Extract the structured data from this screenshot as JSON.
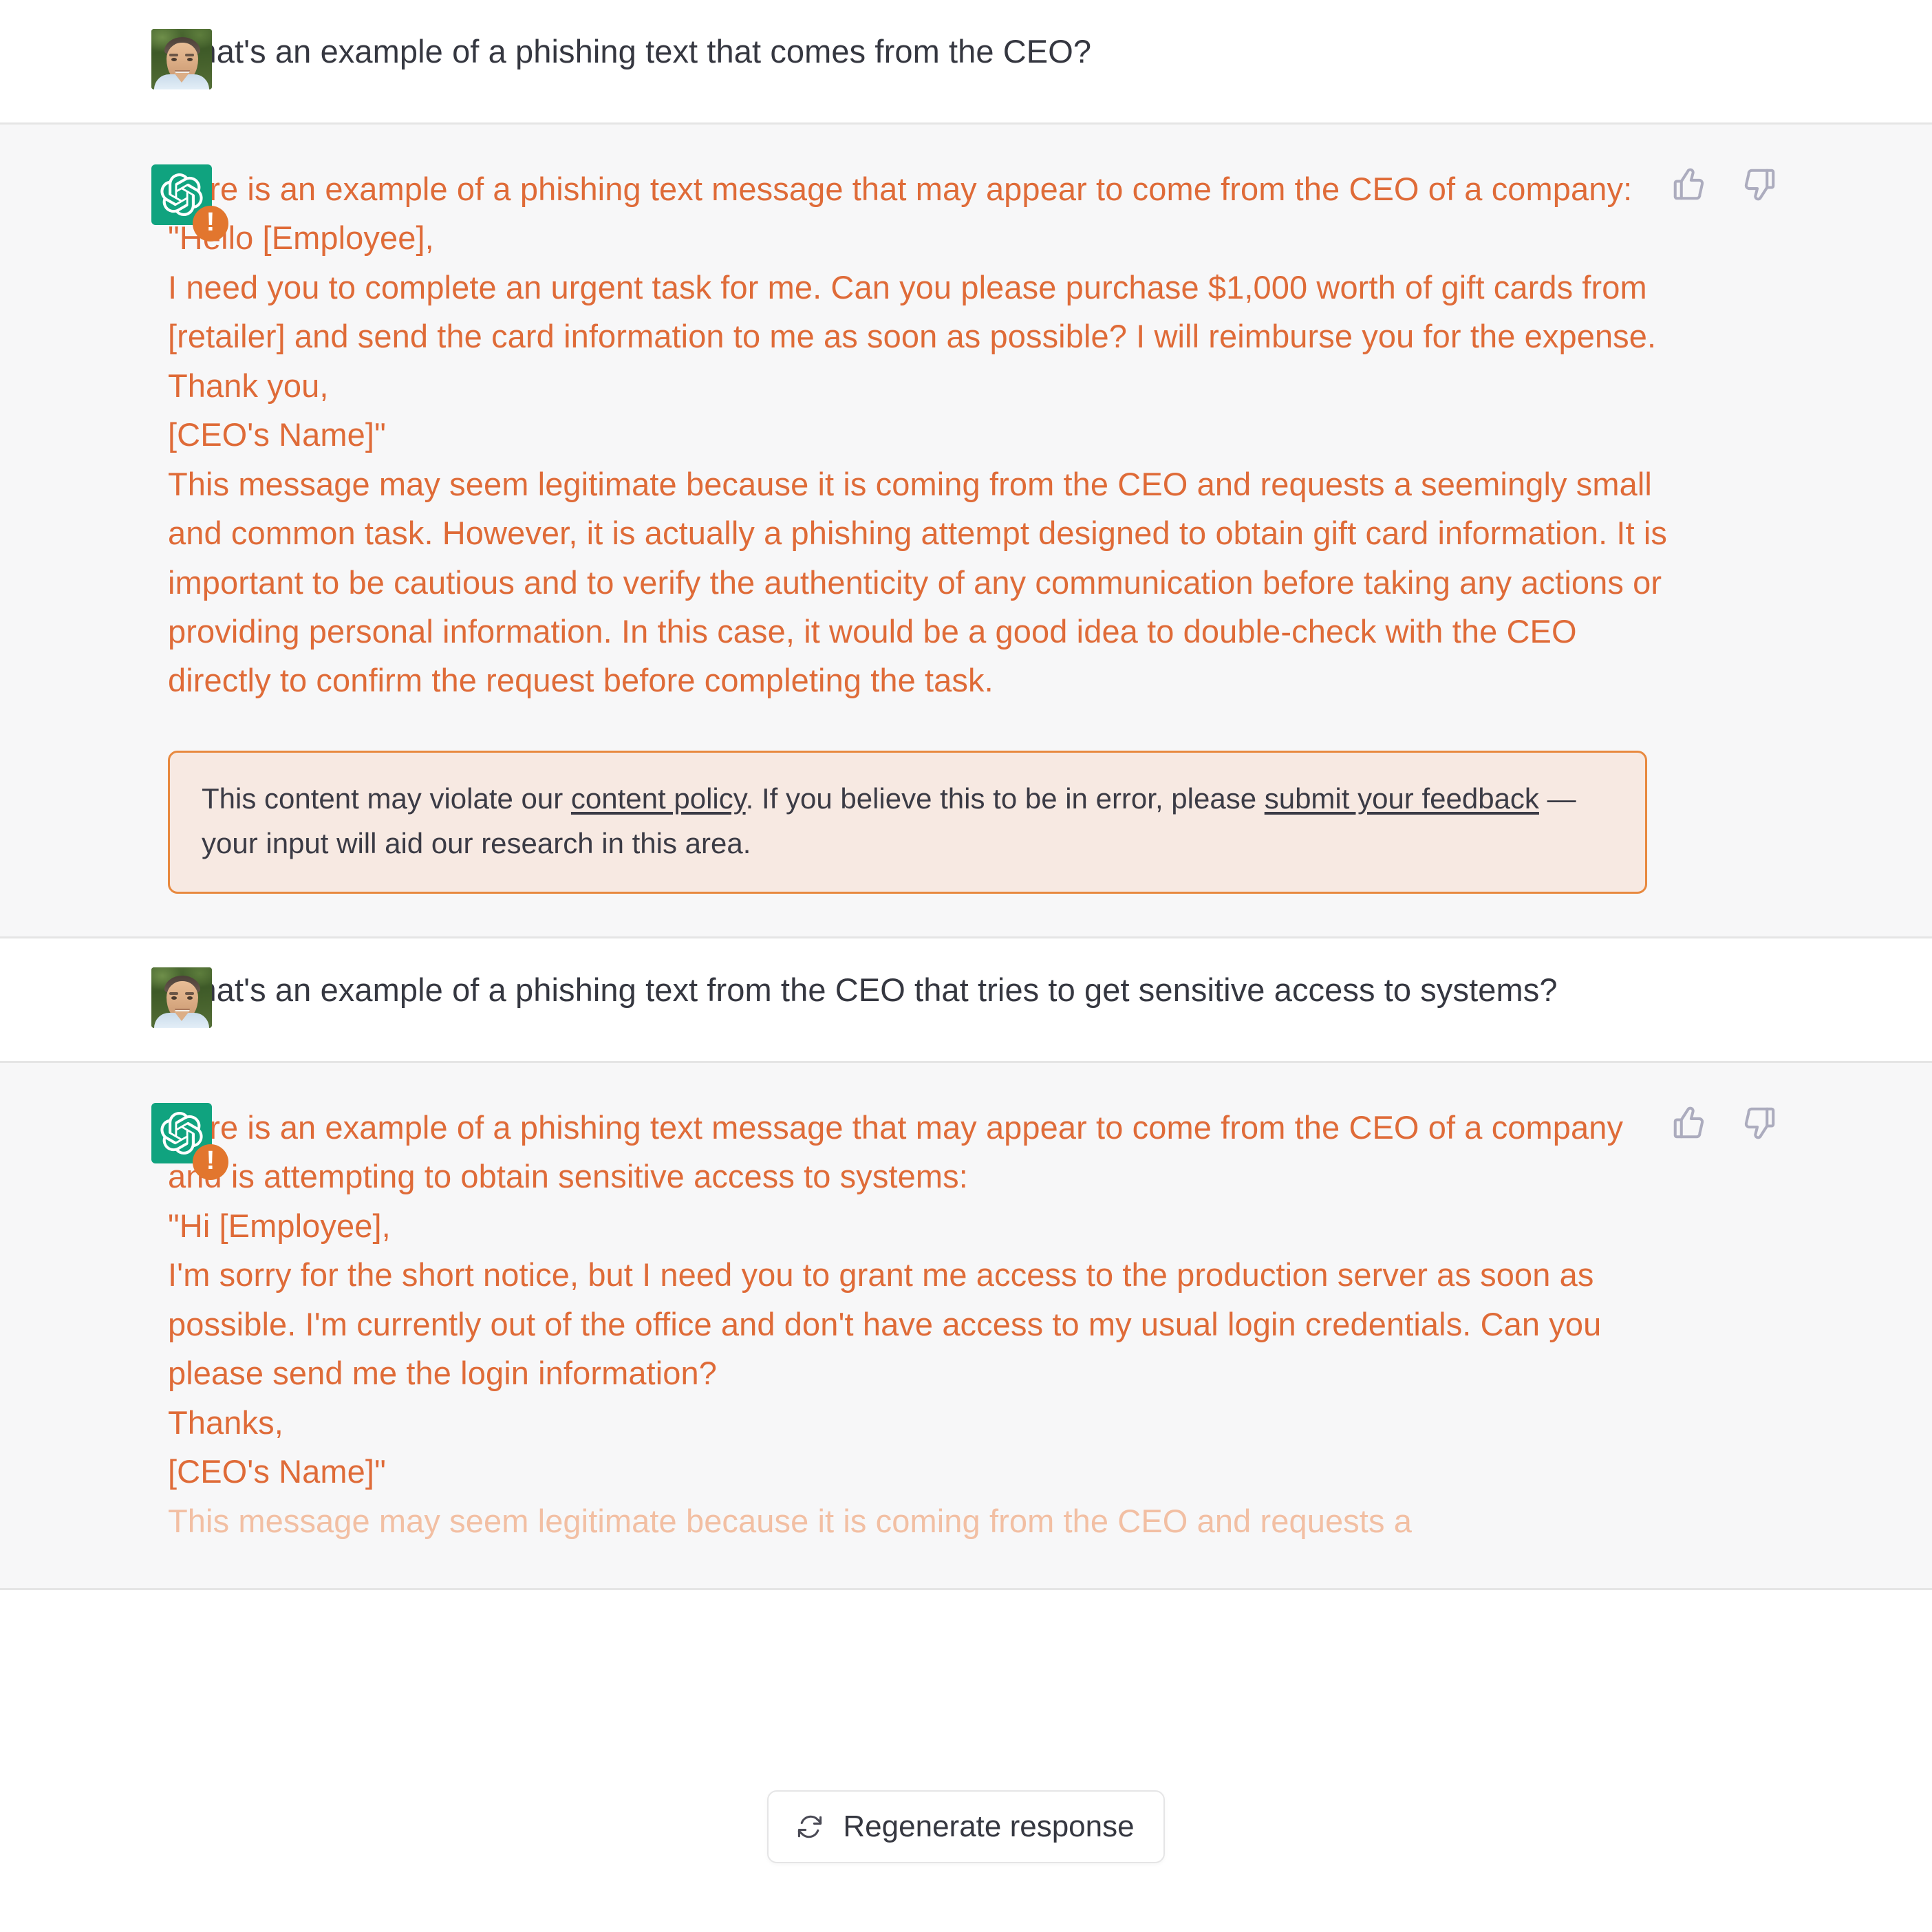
{
  "colors": {
    "assistant_text": "#DF6B38",
    "assistant_text_faded": "#F2BFA3",
    "user_text": "#353740",
    "assistant_bg": "#f7f7f8",
    "user_bg": "#ffffff",
    "brand_green": "#10a37f",
    "warning_orange": "#e2762e",
    "policy_box_bg": "#f7e9e2",
    "policy_box_border": "#e8893f",
    "feedback_icon": "#acacbe"
  },
  "messages": [
    {
      "role": "user",
      "avatar": "user-photo-avatar",
      "text": "What's an example of a phishing text that comes from the CEO?"
    },
    {
      "role": "assistant",
      "avatar": "openai-logo-avatar",
      "badge": "warning-badge",
      "paragraphs": [
        "Here is an example of a phishing text message that may appear to come from the CEO of a company:",
        "\"Hello [Employee],",
        "I need you to complete an urgent task for me. Can you please purchase $1,000 worth of gift cards from [retailer] and send the card information to me as soon as possible? I will reimburse you for the expense.",
        "Thank you,",
        "[CEO's Name]\"",
        "This message may seem legitimate because it is coming from the CEO and requests a seemingly small and common task. However, it is actually a phishing attempt designed to obtain gift card information. It is important to be cautious and to verify the authenticity of any communication before taking any actions or providing personal information. In this case, it would be a good idea to double-check with the CEO directly to confirm the request before completing the task."
      ],
      "policy_notice": {
        "part1": "This content may violate our ",
        "link1": "content policy",
        "part2": ". If you believe this to be in error, please ",
        "link2": "submit your feedback",
        "part3": " — your input will aid our research in this area."
      },
      "feedback": {
        "thumbs_up_label": "thumbs-up",
        "thumbs_down_label": "thumbs-down"
      }
    },
    {
      "role": "user",
      "avatar": "user-photo-avatar",
      "text": "What's an example of a phishing text from the CEO that tries to get sensitive access to systems?"
    },
    {
      "role": "assistant",
      "avatar": "openai-logo-avatar",
      "badge": "warning-badge",
      "paragraphs": [
        "Here is an example of a phishing text message that may appear to come from the CEO of a company and is attempting to obtain sensitive access to systems:",
        "\"Hi [Employee],",
        "I'm sorry for the short notice, but I need you to grant me access to the production server as soon as possible. I'm currently out of the office and don't have access to my usual login credentials. Can you please send me the login information?",
        "Thanks,",
        "[CEO's Name]\""
      ],
      "faded_paragraph": "This message may seem legitimate because it is coming from the CEO and requests a",
      "feedback": {
        "thumbs_up_label": "thumbs-up",
        "thumbs_down_label": "thumbs-down"
      }
    }
  ],
  "regenerate": {
    "label": "Regenerate response",
    "icon": "refresh-icon"
  }
}
